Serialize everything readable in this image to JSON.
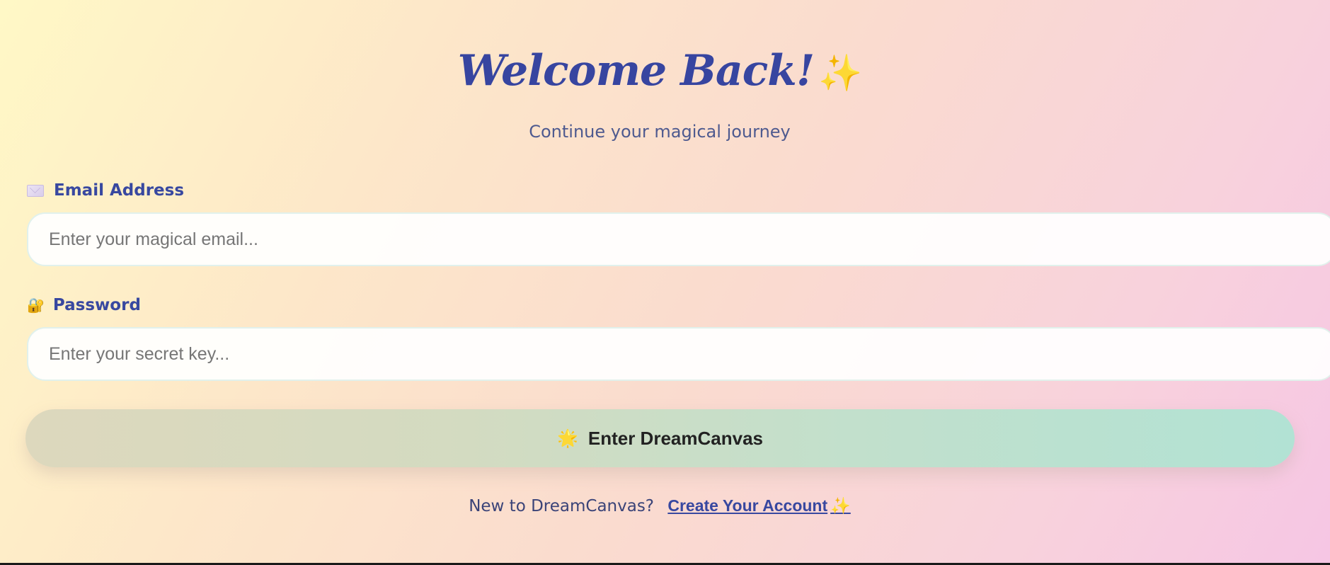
{
  "header": {
    "title": "Welcome Back!",
    "title_icon": "✨",
    "subtitle": "Continue your magical journey"
  },
  "form": {
    "email": {
      "label": "Email Address",
      "icon": "envelope-icon",
      "placeholder": "Enter your magical email...",
      "value": ""
    },
    "password": {
      "label": "Password",
      "icon": "lock-icon",
      "icon_glyph": "🔐",
      "placeholder": "Enter your secret key...",
      "value": ""
    },
    "submit": {
      "icon_glyph": "🌟",
      "label": "Enter DreamCanvas"
    }
  },
  "footer": {
    "prompt": "New to DreamCanvas?",
    "link_label": "Create Your Account",
    "link_icon": "✨"
  },
  "colors": {
    "accent": "#3848a0",
    "button_start": "#ddd8bd",
    "button_end": "#b2e2d4",
    "background_start": "#fff8c6",
    "background_end": "#f6c6e4"
  }
}
